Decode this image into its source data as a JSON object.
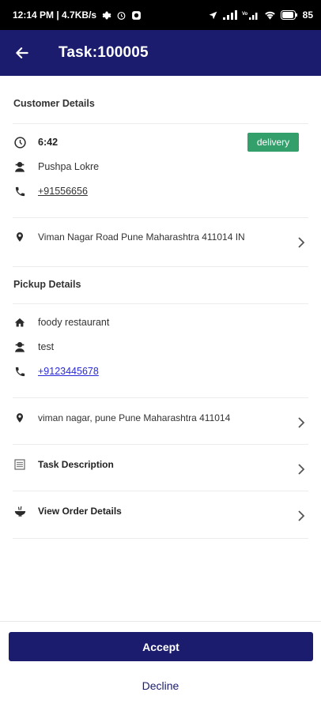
{
  "status_bar": {
    "time_speed": "12:14 PM | 4.7KB/s",
    "battery": "85"
  },
  "app_bar": {
    "title": "Task:100005"
  },
  "customer": {
    "section_title": "Customer Details",
    "time": "6:42",
    "badge": "delivery",
    "name": "Pushpa Lokre",
    "phone": "+91556656",
    "address": "Viman Nagar Road Pune Maharashtra 411014 IN"
  },
  "pickup": {
    "section_title": "Pickup Details",
    "place": "foody restaurant",
    "contact": "test",
    "phone": "+9123445678",
    "address": "viman nagar, pune Pune Maharashtra 411014"
  },
  "links": {
    "task_description": "Task Description",
    "view_order_details": "View Order Details"
  },
  "actions": {
    "accept": "Accept",
    "decline": "Decline"
  },
  "colors": {
    "primary": "#1b1c6e",
    "badge": "#33a06c",
    "link_blue": "#2a2ad6"
  }
}
